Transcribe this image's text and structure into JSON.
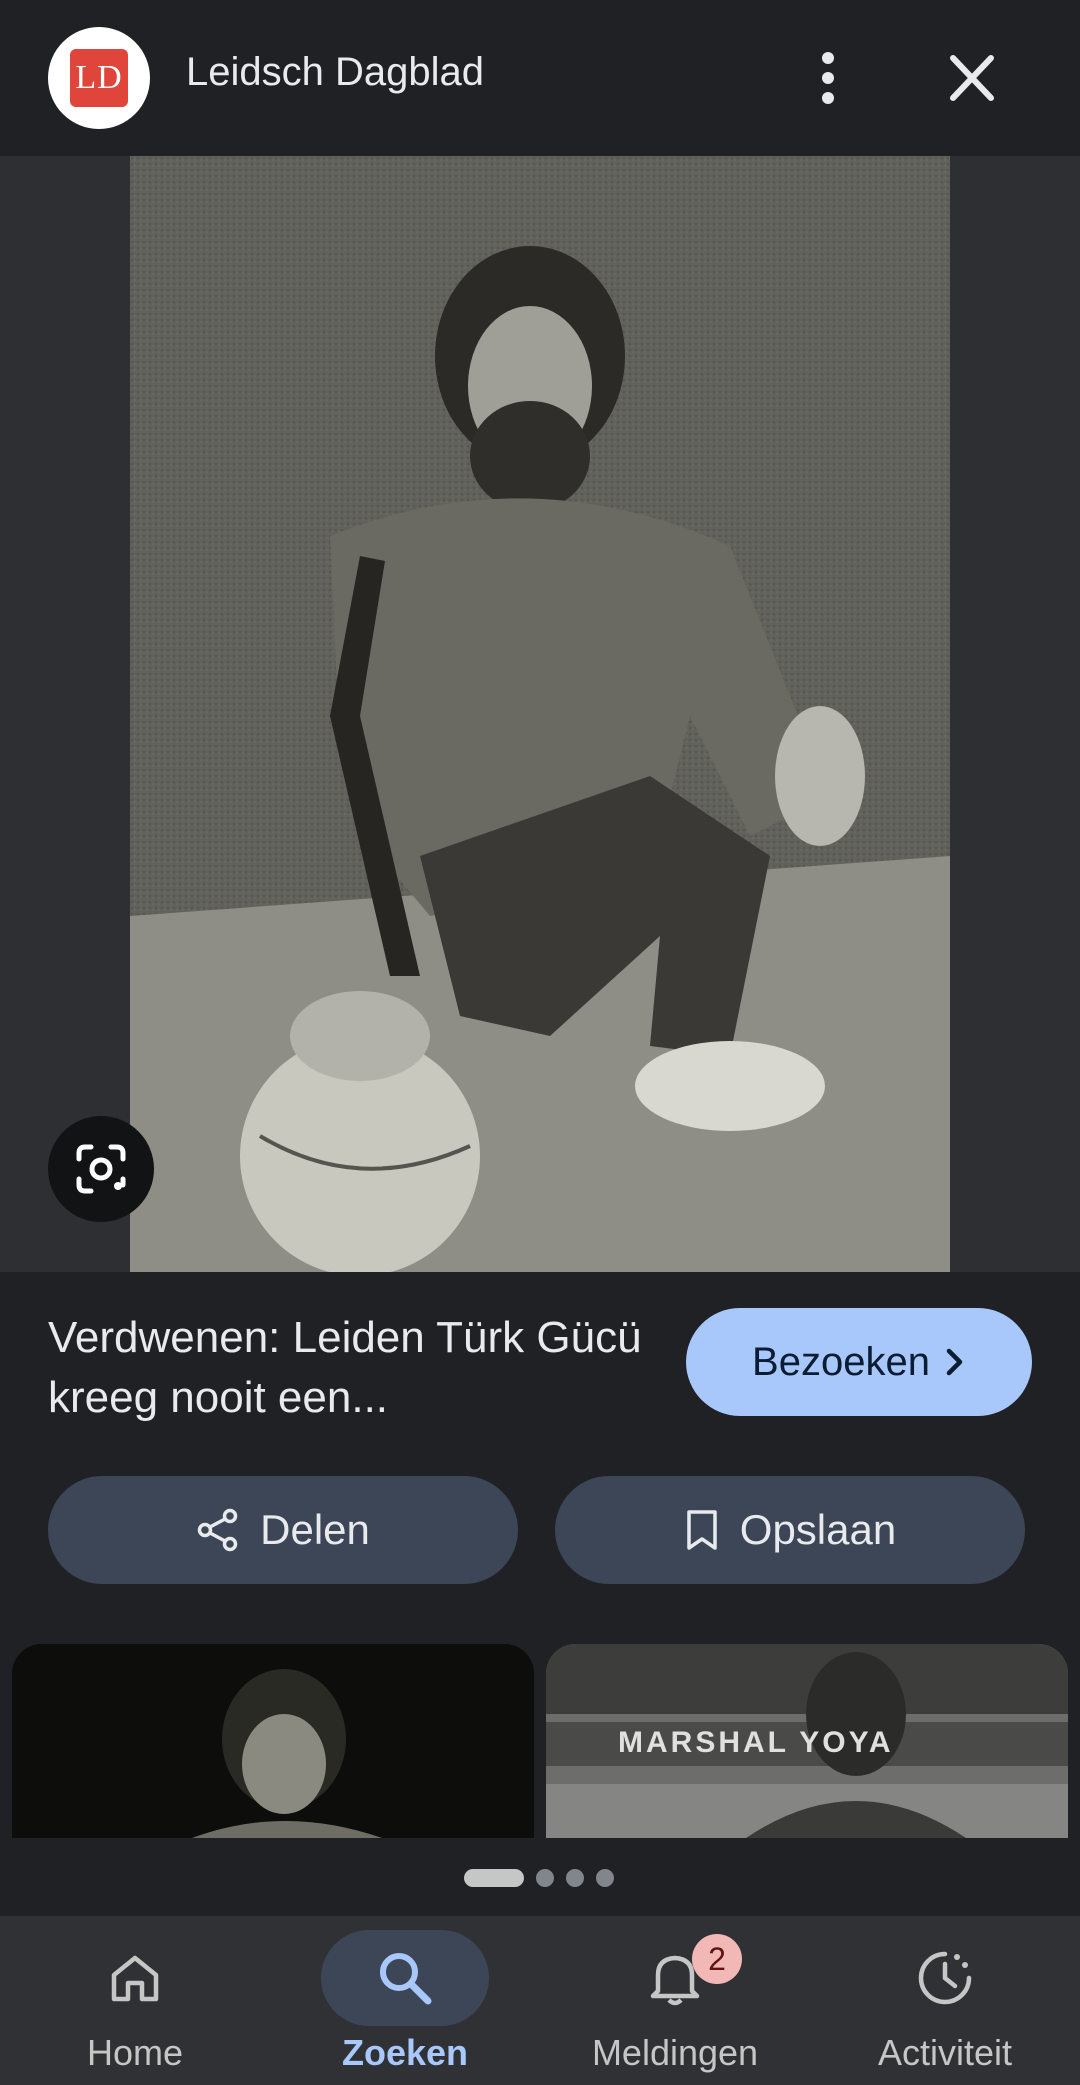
{
  "header": {
    "logo_text": "LD",
    "source_name": "Leidsch Dagblad"
  },
  "result": {
    "title": "Verdwenen: Leiden Türk Gücü kreeg nooit een...",
    "visit_label": "Bezoeken"
  },
  "actions": {
    "share_label": "Delen",
    "save_label": "Opslaan"
  },
  "related": [
    {
      "name": "related-image-1"
    },
    {
      "name": "related-image-2",
      "banner_text": "MARSHAL   YOYA"
    }
  ],
  "pagination": {
    "total": 4,
    "current": 1
  },
  "bottom_nav": {
    "items": [
      {
        "label": "Home",
        "icon": "home-icon"
      },
      {
        "label": "Zoeken",
        "icon": "search-icon",
        "active": true
      },
      {
        "label": "Meldingen",
        "icon": "bell-icon",
        "badge": "2"
      },
      {
        "label": "Activiteit",
        "icon": "activity-icon"
      }
    ]
  },
  "colors": {
    "background": "#202124",
    "accent": "#a8c7fa",
    "pill": "#3c4656",
    "logo_red": "#e0453b",
    "badge": "#f2b8b5"
  }
}
